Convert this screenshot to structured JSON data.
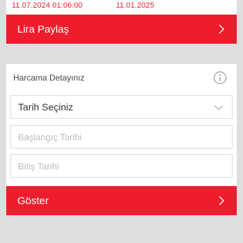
{
  "summary": {
    "start_date": "11.07.2024 01:06:00",
    "end_date": "11.01.2025"
  },
  "share_button": {
    "label": "Lira Paylaş",
    "icon": "chevron-right-icon"
  },
  "spending_detail": {
    "title": "Harcama Detayınız",
    "info_icon": "info-icon",
    "date_select": {
      "value": "Tarih Seçiniz",
      "icon": "chevron-down-icon"
    },
    "start_date": {
      "placeholder": "Başlangıç Tarihi"
    },
    "end_date": {
      "placeholder": "Bitiş Tarihi"
    }
  },
  "show_button": {
    "label": "Göster",
    "icon": "chevron-right-icon"
  },
  "colors": {
    "accent": "#ee1d2d",
    "background": "#dedede",
    "text_red": "#e5202e"
  }
}
